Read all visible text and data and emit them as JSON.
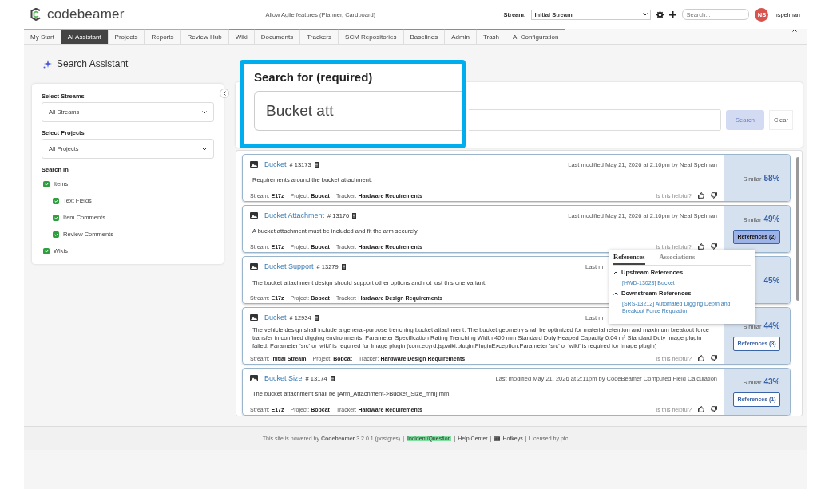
{
  "header": {
    "logo": "codebeamer",
    "notice": "Allow Agile features (Planner, Cardboard)",
    "stream_label": "Stream:",
    "stream_value": "Initial Stream",
    "search_placeholder": "Search...",
    "avatar_initials": "NS",
    "username": "nspelman"
  },
  "tabs": [
    {
      "label": "My Start",
      "selected": false,
      "color": "#f0a030"
    },
    {
      "label": "AI Assistant",
      "selected": true,
      "color": "#f0a030"
    },
    {
      "label": "Projects",
      "selected": false,
      "color": "#f0a030"
    },
    {
      "label": "Reports",
      "selected": false,
      "color": "#f0a030"
    },
    {
      "label": "Review Hub",
      "selected": false,
      "color": "#f0a030"
    },
    {
      "label": "Wiki",
      "selected": false,
      "color": "#3cb878"
    },
    {
      "label": "Documents",
      "selected": false,
      "color": "#3cb878"
    },
    {
      "label": "Trackers",
      "selected": false,
      "color": "#3cb878"
    },
    {
      "label": "SCM Repositories",
      "selected": false,
      "color": "#3cb878"
    },
    {
      "label": "Baselines",
      "selected": false,
      "color": "#3cb878"
    },
    {
      "label": "Admin",
      "selected": false,
      "color": "#3cb878"
    },
    {
      "label": "Trash",
      "selected": false,
      "color": "#3cb878"
    },
    {
      "label": "AI Configuration",
      "selected": false,
      "color": "#3cb878"
    }
  ],
  "page_title": "Search Assistant",
  "filters": {
    "streams_label": "Select Streams",
    "streams_value": "All Streams",
    "projects_label": "Select Projects",
    "projects_value": "All Projects",
    "search_in_label": "Search In",
    "options": [
      {
        "label": "Items",
        "checked": true,
        "children": [
          {
            "label": "Text Fields",
            "checked": true
          },
          {
            "label": "Item Comments",
            "checked": true
          },
          {
            "label": "Review Comments",
            "checked": true
          }
        ]
      },
      {
        "label": "Wikis",
        "checked": true
      }
    ]
  },
  "search": {
    "label": "Search for (required)",
    "value": "Bucket att",
    "button": "Search",
    "button_disabled": true,
    "clear": "Clear"
  },
  "results": [
    {
      "title": "Bucket",
      "id": "# 13173",
      "modified": "Last modified May 21, 2026 at 2:10pm by Neal Spelman",
      "description": "Requirements around the bucket attachment.",
      "meta": [
        {
          "label": "Stream:",
          "value": "E17z"
        },
        {
          "label": "Project:",
          "value": "Bobcat"
        },
        {
          "label": "Tracker:",
          "value": "Hardware Requirements"
        }
      ],
      "helpful": "Is this helpful?",
      "similar_label": "Similar",
      "similar": "58%"
    },
    {
      "title": "Bucket Attachment",
      "id": "# 13176",
      "modified": "Last modified May 21, 2026 at 2:10pm by Neal Spelman",
      "description": "A bucket attachment must be included and fit the arm securely.",
      "meta": [
        {
          "label": "Stream:",
          "value": "E17z"
        },
        {
          "label": "Project:",
          "value": "Bobcat"
        },
        {
          "label": "Tracker:",
          "value": "Hardware Requirements"
        }
      ],
      "helpful": "Is this helpful?",
      "similar_label": "Similar",
      "similar": "49%",
      "references": "References (2)",
      "references_active": true
    },
    {
      "title": "Bucket Support",
      "id": "# 13279",
      "modified": "Last m",
      "description": "The bucket attachment design should support other options and not just this one variant.",
      "meta": [
        {
          "label": "Stream:",
          "value": "E17z"
        },
        {
          "label": "Project:",
          "value": "Bobcat"
        },
        {
          "label": "Tracker:",
          "value": "Hardware Design Requirements"
        }
      ],
      "similar": "45%"
    },
    {
      "title": "Bucket",
      "id": "# 12934",
      "modified": "Last m",
      "description": "The vehicle design shall include a general-purpose trenching bucket attachment. The bucket geometry shall be optimized for material retention and maximum breakout force transfer in confined digging environments. Parameter Specification Rating Trenching Width 400 mm Standard Duty Heaped Capacity 0.04 m³ Standard Duty Image plugin failed: Parameter 'src' or 'wiki' is required for Image plugin (com.ecyrd.jspwiki.plugin.PluginException:Parameter 'src' or 'wiki' is required for Image plugin)",
      "meta": [
        {
          "label": "Stream:",
          "value": "Initial Stream"
        },
        {
          "label": "Project:",
          "value": "Bobcat"
        },
        {
          "label": "Tracker:",
          "value": "Hardware Design Requirements"
        }
      ],
      "helpful": "Is this helpful?",
      "similar_label": "Similar",
      "similar": "44%",
      "references": "References (3)",
      "references_active": false
    },
    {
      "title": "Bucket Size",
      "id": "# 13174",
      "modified": "Last modified May 21, 2026 at 2:11pm by CodeBeamer Computed Field Calculation",
      "description": "The bucket attachment shall be [Arm_Attachment->Bucket_Size_mm] mm.",
      "meta": [
        {
          "label": "Stream:",
          "value": "E17z"
        },
        {
          "label": "Project:",
          "value": "Bobcat"
        },
        {
          "label": "Tracker:",
          "value": "Hardware Requirements"
        }
      ],
      "helpful": "Is this helpful?",
      "similar_label": "Similar",
      "similar": "43%",
      "references": "References (1)",
      "references_active": false
    }
  ],
  "popup": {
    "tabs": [
      {
        "label": "References",
        "selected": true
      },
      {
        "label": "Associations",
        "selected": false
      }
    ],
    "sections": [
      {
        "title": "Upstream References",
        "expanded": true,
        "links": [
          "[HWD-13023] Bucket"
        ]
      },
      {
        "title": "Downstream References",
        "expanded": true,
        "links": [
          "[SRS-13212] Automated Digging Depth and Breakout Force Regulation"
        ]
      }
    ]
  },
  "footer": [
    {
      "kind": "text",
      "text": "This site is powered by **Codebeamer** 3.2.0.1 (postgres)"
    },
    {
      "kind": "separator",
      "text": "|"
    },
    {
      "kind": "highlight",
      "text": "Incident/Question"
    },
    {
      "kind": "separator",
      "text": "|"
    },
    {
      "kind": "link",
      "text": "Help Center"
    },
    {
      "kind": "separator",
      "text": "|"
    },
    {
      "kind": "hotkeys",
      "text": "Hotkeys"
    },
    {
      "kind": "separator",
      "text": "|"
    },
    {
      "kind": "text",
      "text": "Licensed by ptc"
    }
  ]
}
